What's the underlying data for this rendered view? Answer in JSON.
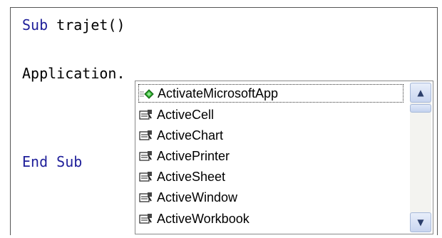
{
  "code": {
    "line1_keyword": "Sub",
    "line1_rest": " trajet()",
    "line2": "Application.",
    "line3": "End Sub"
  },
  "autocomplete": {
    "items": [
      {
        "label": "ActivateMicrosoftApp",
        "icon": "method-icon",
        "selected": true
      },
      {
        "label": "ActiveCell",
        "icon": "property-icon"
      },
      {
        "label": "ActiveChart",
        "icon": "property-icon"
      },
      {
        "label": "ActivePrinter",
        "icon": "property-icon"
      },
      {
        "label": "ActiveSheet",
        "icon": "property-icon"
      },
      {
        "label": "ActiveWindow",
        "icon": "property-icon"
      },
      {
        "label": "ActiveWorkbook",
        "icon": "property-icon"
      }
    ],
    "scroll_up_glyph": "▲",
    "scroll_down_glyph": "▼"
  },
  "colors": {
    "keyword": "#1f1f9a",
    "text": "#000000"
  }
}
